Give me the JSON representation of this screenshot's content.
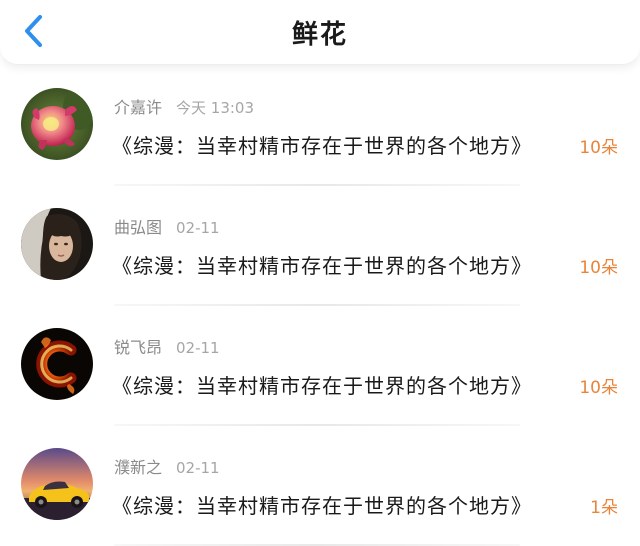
{
  "header": {
    "title": "鲜花",
    "back_icon": "chevron-left-icon",
    "accent_color": "#2e8ff0"
  },
  "items": [
    {
      "name": "介嘉许",
      "time": "今天 13:03",
      "message": "《综漫：当幸村精市存在于世界的各个地方》",
      "count": "10朵",
      "avatar_icon": "dragonfruit-flower-avatar"
    },
    {
      "name": "曲弘图",
      "time": "02-11",
      "message": "《综漫：当幸村精市存在于世界的各个地方》",
      "count": "10朵",
      "avatar_icon": "woman-portrait-avatar"
    },
    {
      "name": "锐飞昂",
      "time": "02-11",
      "message": "《综漫：当幸村精市存在于世界的各个地方》",
      "count": "10朵",
      "avatar_icon": "fire-letter-c-avatar"
    },
    {
      "name": "濮新之",
      "time": "02-11",
      "message": "《综漫：当幸村精市存在于世界的各个地方》",
      "count": "1朵",
      "avatar_icon": "yellow-sports-car-avatar"
    }
  ],
  "colors": {
    "count": "#e8853a",
    "name": "#8a8a8a",
    "time": "#a6a6a6"
  }
}
